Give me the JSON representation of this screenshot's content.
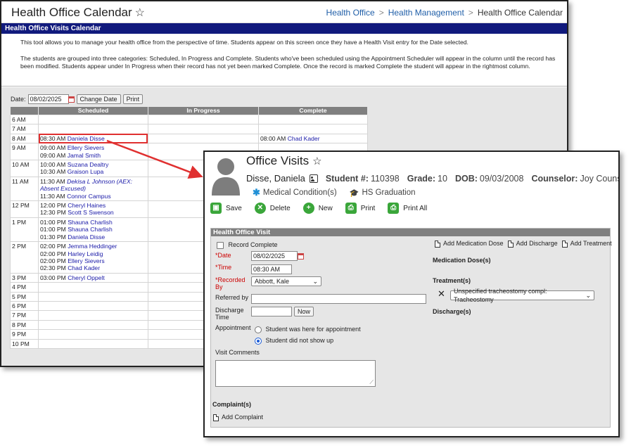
{
  "calendar": {
    "title": "Health Office Calendar",
    "breadcrumb": [
      "Health Office",
      "Health Management",
      "Health Office Calendar"
    ],
    "section_title": "Health Office Visits Calendar",
    "description_1": "This tool allows you to manage your health office from the perspective of time. Students appear on this screen once they have a Health Visit entry for the Date selected.",
    "description_2": "The students are grouped into three categories: Scheduled, In Progress and Complete. Students who've been scheduled using the Appointment Scheduler will appear in the column until the record has been modified. Students appear under In Progress when their record has not yet been marked Complete. Once the record is marked Complete the student will appear in the rightmost column.",
    "date_label": "Date:",
    "date_value": "08/02/2025",
    "change_date_label": "Change Date",
    "print_label": "Print",
    "columns": [
      "",
      "Scheduled",
      "In Progress",
      "Complete"
    ],
    "rows": [
      {
        "hour": "6 AM",
        "scheduled": [],
        "complete": []
      },
      {
        "hour": "7 AM",
        "scheduled": [],
        "complete": []
      },
      {
        "hour": "8 AM",
        "scheduled": [
          {
            "time": "08:30 AM",
            "name": "Daniela Disse",
            "italic": false,
            "highlight": true
          }
        ],
        "complete": [
          {
            "time": "08:00 AM",
            "name": "Chad Kader"
          }
        ]
      },
      {
        "hour": "9 AM",
        "scheduled": [
          {
            "time": "09:00 AM",
            "name": "Ellery Sievers"
          },
          {
            "time": "09:00 AM",
            "name": "Jamal Smith"
          }
        ],
        "complete": []
      },
      {
        "hour": "10 AM",
        "scheduled": [
          {
            "time": "10:00 AM",
            "name": "Suzana Dealtry"
          },
          {
            "time": "10:30 AM",
            "name": "Graison Lupa"
          }
        ],
        "complete": []
      },
      {
        "hour": "11 AM",
        "scheduled": [
          {
            "time": "11:30 AM",
            "name": "Dekisa L Johnson (AEX:",
            "italic": true
          },
          {
            "time": "",
            "name": "Absent Excused)",
            "italic": true
          },
          {
            "time": "11:30 AM",
            "name": "Connor Campus"
          }
        ],
        "complete": []
      },
      {
        "hour": "12 PM",
        "scheduled": [
          {
            "time": "12:00 PM",
            "name": "Cheryl Haines"
          },
          {
            "time": "12:30 PM",
            "name": "Scott S Swenson"
          }
        ],
        "complete": []
      },
      {
        "hour": "1 PM",
        "scheduled": [
          {
            "time": "01:00 PM",
            "name": "Shauna Charlish"
          },
          {
            "time": "01:00 PM",
            "name": "Shauna Charlish"
          },
          {
            "time": "01:30 PM",
            "name": "Daniela Disse"
          }
        ],
        "complete": []
      },
      {
        "hour": "2 PM",
        "scheduled": [
          {
            "time": "02:00 PM",
            "name": "Jemma Heddinger"
          },
          {
            "time": "02:00 PM",
            "name": "Harley Leidig"
          },
          {
            "time": "02:00 PM",
            "name": "Ellery Sievers"
          },
          {
            "time": "02:30 PM",
            "name": "Chad Kader"
          }
        ],
        "complete": []
      },
      {
        "hour": "3 PM",
        "scheduled": [
          {
            "time": "03:00 PM",
            "name": "Cheryl Oppelt"
          }
        ],
        "complete": []
      },
      {
        "hour": "4 PM",
        "scheduled": [],
        "complete": []
      },
      {
        "hour": "5 PM",
        "scheduled": [],
        "complete": []
      },
      {
        "hour": "6 PM",
        "scheduled": [],
        "complete": []
      },
      {
        "hour": "7 PM",
        "scheduled": [],
        "complete": []
      },
      {
        "hour": "8 PM",
        "scheduled": [],
        "complete": []
      },
      {
        "hour": "9 PM",
        "scheduled": [],
        "complete": []
      },
      {
        "hour": "10 PM",
        "scheduled": [],
        "complete": []
      }
    ]
  },
  "visit": {
    "title": "Office Visits",
    "student_name": "Disse, Daniela",
    "student_num_label": "Student #:",
    "student_num": "110398",
    "grade_label": "Grade:",
    "grade": "10",
    "dob_label": "DOB:",
    "dob": "09/03/2008",
    "counselor_label": "Counselor:",
    "counselor": "Joy Counselor",
    "flag_medical": "Medical Condition(s)",
    "flag_grad": "HS Graduation",
    "toolbar": {
      "save": "Save",
      "delete": "Delete",
      "new": "New",
      "print": "Print",
      "print_all": "Print All"
    },
    "panel_title": "Health Office Visit",
    "record_complete": "Record Complete",
    "date_label": "Date",
    "date_value": "08/02/2025",
    "time_label": "Time",
    "time_value": "08:30 AM",
    "recorded_label_1": "Recorded",
    "recorded_label_2": "By",
    "recorded_value": "Abbott, Kale",
    "referred_label": "Referred by",
    "discharge_label_1": "Discharge",
    "discharge_label_2": "Time",
    "now_label": "Now",
    "appointment_label": "Appointment",
    "appt_here": "Student was here for appointment",
    "appt_no_show": "Student did not show up",
    "comments_label": "Visit Comments",
    "complaints_label": "Complaint(s)",
    "add_complaint": "Add Complaint",
    "add_med_dose": "Add Medication Dose",
    "add_discharge": "Add Discharge",
    "add_treatment": "Add Treatment",
    "med_doses_label": "Medication Dose(s)",
    "treatments_label": "Treatment(s)",
    "treatment_value": "Unspecified tracheostomy compl: Tracheostomy",
    "discharges_label": "Discharge(s)"
  },
  "colors": {
    "header_bar": "#111a7d",
    "link": "#1a1aa8",
    "highlight": "#e03030",
    "action_green": "#3aa63a"
  }
}
